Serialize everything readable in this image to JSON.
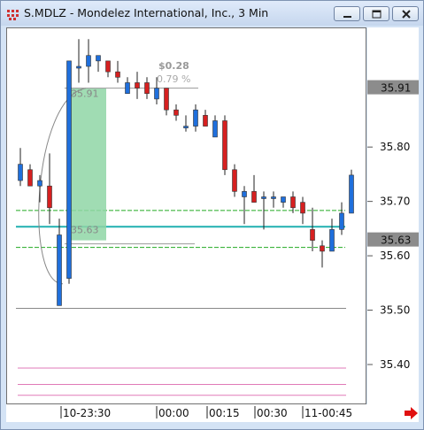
{
  "window": {
    "title": "S.MDLZ - Mondelez International, Inc., 3 Min"
  },
  "icons": {
    "app": "app-menu-icon",
    "minimize": "minimize-icon",
    "restore": "restore-icon",
    "close": "close-icon",
    "scroll_right": "scroll-right-arrow-icon"
  },
  "colors": {
    "up_candle": "#1f6fdc",
    "down_candle": "#d62020",
    "projection_box": "#8fd6a6",
    "midline": "#20b0b0",
    "green_dashed": "#22aa22",
    "pink_lines": "#e07ab8",
    "price_highlight": "#8c8c8c"
  },
  "annotation": {
    "change": "$0.28",
    "percent": "0.79 %",
    "upper_label": "35.91",
    "lower_label": "35.63"
  },
  "chart_data": {
    "type": "candlestick",
    "ylim": [
      35.33,
      36.02
    ],
    "y_ticks": [
      "35.50",
      "35.40"
    ],
    "y_ticks_partial": [
      "35.80",
      "35.70",
      "35.60"
    ],
    "price_tags": [
      "35.91",
      "35.63"
    ],
    "x_tick_labels": [
      "10-23:30",
      "00:00",
      "00:15",
      "00:30",
      "11-00:45"
    ],
    "candles": [
      {
        "o": 35.74,
        "h": 35.8,
        "l": 35.73,
        "c": 35.77
      },
      {
        "o": 35.76,
        "h": 35.77,
        "l": 35.73,
        "c": 35.73
      },
      {
        "o": 35.73,
        "h": 35.75,
        "l": 35.7,
        "c": 35.74
      },
      {
        "o": 35.73,
        "h": 35.79,
        "l": 35.66,
        "c": 35.69
      },
      {
        "o": 35.51,
        "h": 35.67,
        "l": 35.51,
        "c": 35.64
      },
      {
        "o": 35.56,
        "h": 35.63,
        "l": 35.55,
        "c": 35.96
      },
      {
        "o": 35.95,
        "h": 36.0,
        "l": 35.92,
        "c": 35.95
      },
      {
        "o": 35.95,
        "h": 36.0,
        "l": 35.92,
        "c": 35.97
      },
      {
        "o": 35.96,
        "h": 35.97,
        "l": 35.94,
        "c": 35.97
      },
      {
        "o": 35.96,
        "h": 35.96,
        "l": 35.93,
        "c": 35.94
      },
      {
        "o": 35.94,
        "h": 35.96,
        "l": 35.92,
        "c": 35.93
      },
      {
        "o": 35.9,
        "h": 35.93,
        "l": 35.9,
        "c": 35.92
      },
      {
        "o": 35.92,
        "h": 35.94,
        "l": 35.89,
        "c": 35.91
      },
      {
        "o": 35.92,
        "h": 35.93,
        "l": 35.89,
        "c": 35.9
      },
      {
        "o": 35.89,
        "h": 35.93,
        "l": 35.88,
        "c": 35.91
      },
      {
        "o": 35.91,
        "h": 35.91,
        "l": 35.86,
        "c": 35.87
      },
      {
        "o": 35.87,
        "h": 35.88,
        "l": 35.85,
        "c": 35.86
      },
      {
        "o": 35.84,
        "h": 35.86,
        "l": 35.83,
        "c": 35.84
      },
      {
        "o": 35.84,
        "h": 35.88,
        "l": 35.83,
        "c": 35.87
      },
      {
        "o": 35.86,
        "h": 35.87,
        "l": 35.84,
        "c": 35.84
      },
      {
        "o": 35.82,
        "h": 35.86,
        "l": 35.82,
        "c": 35.85
      },
      {
        "o": 35.85,
        "h": 35.86,
        "l": 35.75,
        "c": 35.76
      },
      {
        "o": 35.76,
        "h": 35.77,
        "l": 35.71,
        "c": 35.72
      },
      {
        "o": 35.71,
        "h": 35.73,
        "l": 35.66,
        "c": 35.72
      },
      {
        "o": 35.72,
        "h": 35.75,
        "l": 35.7,
        "c": 35.7
      },
      {
        "o": 35.71,
        "h": 35.72,
        "l": 35.65,
        "c": 35.71
      },
      {
        "o": 35.71,
        "h": 35.72,
        "l": 35.69,
        "c": 35.71
      },
      {
        "o": 35.7,
        "h": 35.71,
        "l": 35.69,
        "c": 35.71
      },
      {
        "o": 35.71,
        "h": 35.72,
        "l": 35.68,
        "c": 35.69
      },
      {
        "o": 35.7,
        "h": 35.71,
        "l": 35.66,
        "c": 35.68
      },
      {
        "o": 35.65,
        "h": 35.69,
        "l": 35.61,
        "c": 35.63
      },
      {
        "o": 35.62,
        "h": 35.63,
        "l": 35.58,
        "c": 35.61
      },
      {
        "o": 35.61,
        "h": 35.67,
        "l": 35.61,
        "c": 35.65
      },
      {
        "o": 35.65,
        "h": 35.7,
        "l": 35.64,
        "c": 35.68
      },
      {
        "o": 35.68,
        "h": 35.76,
        "l": 35.68,
        "c": 35.75
      }
    ],
    "lines": [
      {
        "name": "midline",
        "y": 35.655,
        "style": "solid",
        "color": "#20b0b0"
      },
      {
        "name": "upper-dashed",
        "y": 35.685,
        "style": "dashed",
        "color": "#22aa22"
      },
      {
        "name": "lower-dashed",
        "y": 35.617,
        "style": "dashed",
        "color": "#22aa22"
      },
      {
        "name": "low-gray",
        "y": 35.505,
        "style": "solid",
        "color": "#888888"
      },
      {
        "name": "pink-1",
        "y": 35.395,
        "style": "solid",
        "color": "#e07ab8"
      },
      {
        "name": "pink-2",
        "y": 35.365,
        "style": "solid",
        "color": "#e07ab8"
      },
      {
        "name": "pink-3",
        "y": 35.345,
        "style": "solid",
        "color": "#e07ab8"
      }
    ],
    "projection": {
      "from": 5,
      "to": 9,
      "high": 35.91,
      "low": 35.63
    }
  }
}
